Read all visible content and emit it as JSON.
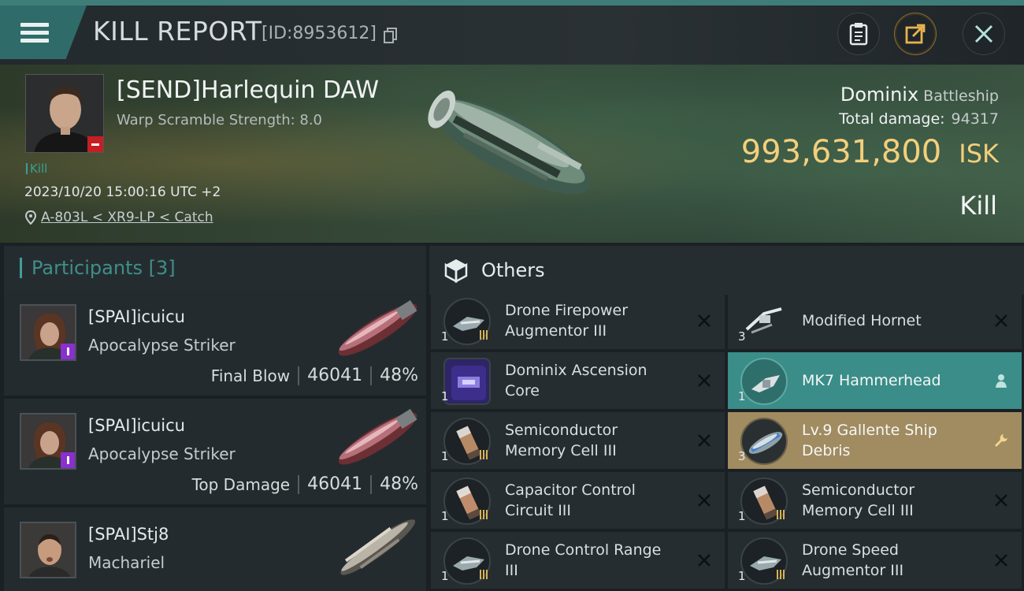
{
  "header": {
    "title": "KILL REPORT",
    "report_id": "[ID:8953612]"
  },
  "victim": {
    "name": "[SEND]Harlequin DAW",
    "warp_scramble": "Warp Scramble Strength: 8.0",
    "result_tag": "Kill",
    "datetime": "2023/10/20 15:00:16 UTC +2",
    "location": "A-803L < XR9-LP < Catch",
    "ship_name": "Dominix",
    "ship_class": "Battleship",
    "total_damage_label": "Total damage:",
    "total_damage": "94317",
    "isk_value": "993,631,800",
    "isk_unit": "ISK",
    "outcome": "Kill"
  },
  "participants": {
    "label": "Participants",
    "count": "[3]",
    "rows": [
      {
        "name": "[SPAI]icuicu",
        "ship": "Apocalypse Striker",
        "role": "Final Blow",
        "damage": "46041",
        "percent": "48%"
      },
      {
        "name": "[SPAI]icuicu",
        "ship": "Apocalypse Striker",
        "role": "Top Damage",
        "damage": "46041",
        "percent": "48%"
      },
      {
        "name": "[SPAI]Stj8",
        "ship": "Machariel"
      }
    ]
  },
  "others": {
    "label": "Others",
    "items": [
      {
        "name_line1": "Drone Firepower",
        "name_line2": "Augmentor III",
        "qty": "1"
      },
      {
        "name_line1": "Modified Hornet",
        "name_line2": "",
        "qty": "3"
      },
      {
        "name_line1": "Dominix Ascension",
        "name_line2": "Core",
        "qty": "1"
      },
      {
        "name_line1": "MK7  Hammerhead",
        "name_line2": "",
        "qty": "1"
      },
      {
        "name_line1": "Semiconductor",
        "name_line2": "Memory Cell III",
        "qty": "1"
      },
      {
        "name_line1": "Lv.9 Gallente Ship",
        "name_line2": "Debris",
        "qty": "3"
      },
      {
        "name_line1": "Capacitor Control",
        "name_line2": "Circuit III",
        "qty": "1"
      },
      {
        "name_line1": "Semiconductor",
        "name_line2": "Memory Cell III",
        "qty": "1"
      },
      {
        "name_line1": "Drone Control Range",
        "name_line2": "III",
        "qty": "1"
      },
      {
        "name_line1": "Drone Speed",
        "name_line2": "Augmentor III",
        "qty": "1"
      }
    ]
  },
  "colors": {
    "accent_teal": "#3a8d88",
    "isk_gold": "#f3cf7c",
    "highlight_gold": "#a18b60",
    "negative_red": "#c51f24"
  }
}
